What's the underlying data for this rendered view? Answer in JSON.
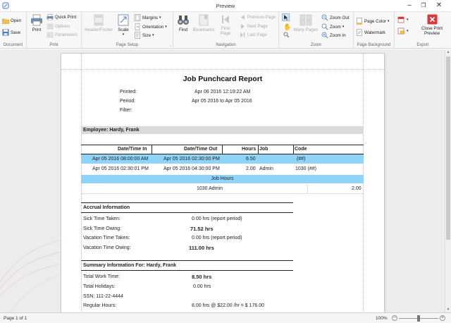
{
  "window": {
    "title": "Preview"
  },
  "ribbon": {
    "document": {
      "label": "Document",
      "open": "Open",
      "save": "Save"
    },
    "print": {
      "label": "Print",
      "print": "Print",
      "quick_print": "Quick Print",
      "options": "Options",
      "parameters": "Parameters"
    },
    "page_setup": {
      "label": "Page Setup",
      "header_footer": "Header/Footer",
      "scale": "Scale",
      "margins": "Margins",
      "orientation": "Orientation",
      "size": "Size"
    },
    "navigation": {
      "label": "Navigation",
      "find": "Find",
      "bookmarks": "Bookmarks",
      "first_page": "First Page",
      "previous_page": "Previous Page",
      "next_page": "Next Page",
      "last_page": "Last Page"
    },
    "zoom": {
      "label": "Zoom",
      "many_pages": "Many Pages",
      "zoom_out": "Zoom Out",
      "zoom": "Zoom",
      "zoom_in": "Zoom In"
    },
    "page_background": {
      "label": "Page Background",
      "page_color": "Page Color",
      "watermark": "Watermark"
    },
    "export": {
      "label": "Export",
      "close_print_preview": "Close Print Preview"
    }
  },
  "report": {
    "title": "Job Punchcard Report",
    "printed_label": "Printed:",
    "printed_value": "Apr 06 2016 12:19:22 AM",
    "period_label": "Period:",
    "period_value": "Apr 05 2016 to Apr 05 2016",
    "filter_label": "Filter:",
    "employee_header": "Employee: Hardy, Frank",
    "table_headers": {
      "datetime_in": "Date/Time In",
      "datetime_out": "Date/Time Out",
      "hours": "Hours",
      "job": "Job",
      "code": "Code"
    },
    "rows": [
      {
        "in": "Apr 05 2016 08:00:00 AM",
        "out": "Apr 05 2016 02:30:00 PM",
        "hours": "6.50",
        "job": "",
        "code": "(##)"
      },
      {
        "in": "Apr 05 2016 02:30:01 PM",
        "out": "Apr 05 2016 04:30:00 PM",
        "hours": "2.00",
        "job": "Admin",
        "code": "1030 (##)"
      }
    ],
    "job_hours_label": "Job Hours",
    "job_hours_row": {
      "job": "1030 Admin",
      "hours": "2.00"
    },
    "accrual": {
      "title": "Accrual Information",
      "items": [
        {
          "label": "Sick Time Taken:",
          "value": "0.00 hrs (report period)",
          "bold": false
        },
        {
          "label": "Sick Time Owing:",
          "value": "71.52 hrs",
          "bold": true
        },
        {
          "label": "Vacation Time Taken:",
          "value": "0.00 hrs (report period)",
          "bold": false
        },
        {
          "label": "Vacation Time Owing:",
          "value": "111.00 hrs",
          "bold": true
        }
      ]
    },
    "summary": {
      "title": "Summary Information For: Hardy, Frank",
      "items": [
        {
          "label": "Total Work Time:",
          "value": "8.50 hrs",
          "bold": true
        },
        {
          "label": "Total Holidays:",
          "value": "0.00 hrs",
          "bold": false
        },
        {
          "label": "SSN: 111-22-4444",
          "value": "",
          "bold": false
        },
        {
          "label": "Regular Hours:",
          "value": "8.00 hrs @ $22.00 /hr = $ 176.00",
          "bold": false
        }
      ]
    }
  },
  "status": {
    "page": "Page 1 of 1",
    "zoom": "100%",
    "zoom_level": 0.5
  },
  "colors": {
    "selection": "#8fd3f6",
    "close_red": "#d9393b"
  }
}
